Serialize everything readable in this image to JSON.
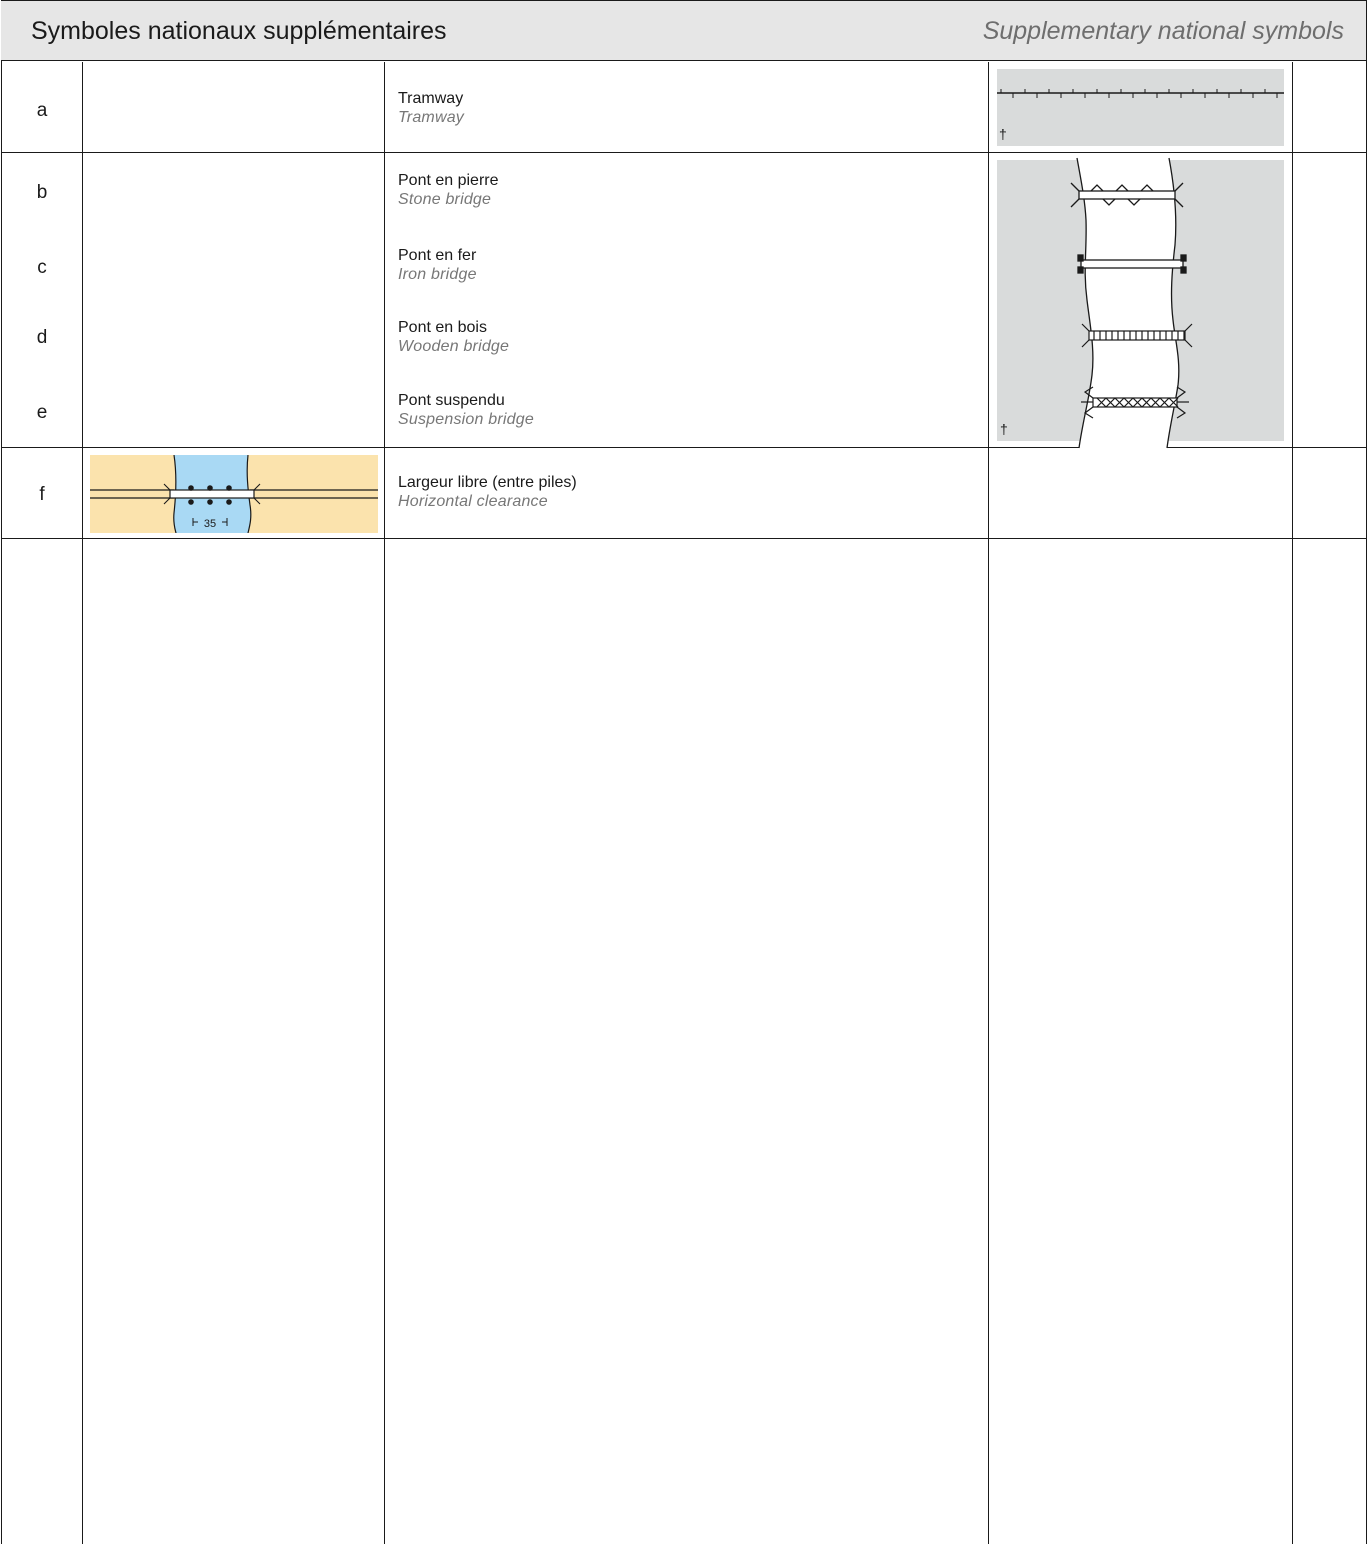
{
  "header": {
    "title_fr": "Symboles nationaux supplémentaires",
    "title_en": "Supplementary national symbols"
  },
  "rows": [
    {
      "letter": "a",
      "fr": "Tramway",
      "en": "Tramway"
    },
    {
      "letter": "b",
      "fr": "Pont en pierre",
      "en": "Stone bridge"
    },
    {
      "letter": "c",
      "fr": "Pont en fer",
      "en": "Iron bridge"
    },
    {
      "letter": "d",
      "fr": "Pont en bois",
      "en": "Wooden bridge"
    },
    {
      "letter": "e",
      "fr": "Pont suspendu",
      "en": "Suspension bridge"
    },
    {
      "letter": "f",
      "fr": "Largeur libre (entre piles)",
      "en": "Horizontal clearance"
    }
  ],
  "symbols": {
    "dagger": "†",
    "clearance_label": "35"
  },
  "colors": {
    "header_bg": "#e6e6e6",
    "symbol_bg": "#d9dbdb",
    "land": "#fbe3ad",
    "water": "#a9d9f4",
    "rule": "#1a1a1a",
    "english_text": "#777777"
  }
}
